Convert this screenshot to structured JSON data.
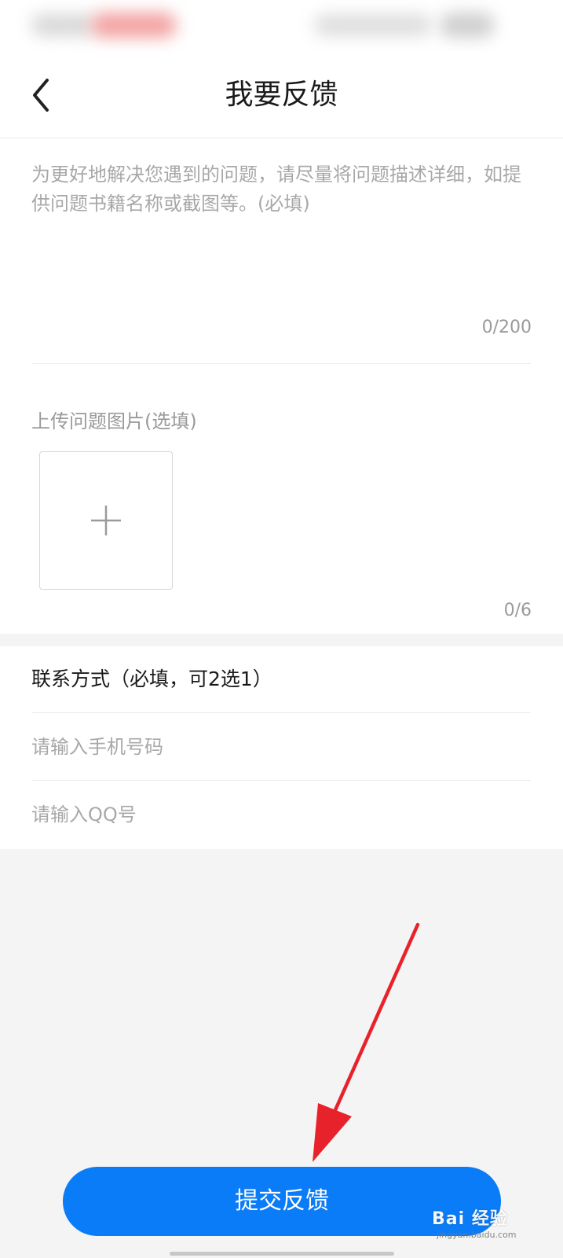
{
  "header": {
    "title": "我要反馈"
  },
  "description": {
    "placeholder": "为更好地解决您遇到的问题，请尽量将问题描述详细，如提供问题书籍名称或截图等。(必填)",
    "counter": "0/200"
  },
  "upload": {
    "label": "上传问题图片(选填)",
    "counter": "0/6"
  },
  "contact": {
    "title": "联系方式（必填，可2选1）",
    "phone_placeholder": "请输入手机号码",
    "qq_placeholder": "请输入QQ号"
  },
  "submit": {
    "label": "提交反馈"
  },
  "watermark": {
    "text": "Bai 经验",
    "sub": "jingyan.baidu.com"
  },
  "colors": {
    "accent": "#0a7cf7",
    "annotation_arrow": "#e8222a",
    "page_background": "#f4f4f4"
  }
}
